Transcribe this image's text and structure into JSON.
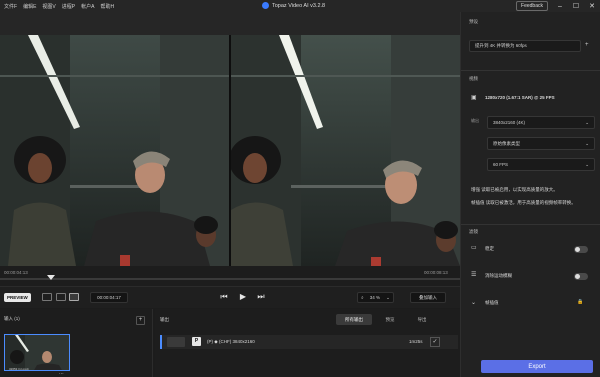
{
  "menus": [
    "文件F",
    "编辑E",
    "视图V",
    "进程P",
    "帐户A",
    "帮助H"
  ],
  "app": {
    "title": "Topaz Video AI  v3.2.8",
    "feedback": "Feedback"
  },
  "timeline": {
    "start": "00:00:04:13",
    "end": "00:00:08:13",
    "progress": 0.11
  },
  "controls": {
    "preview_label": "PREVIEW",
    "timecode": "00:00:04:17",
    "zoom": "34 %",
    "compare": "叠加输入"
  },
  "input": {
    "header": "输入 (1)",
    "add": "+",
    "file_caption": "32653 (1).mp4"
  },
  "output": {
    "header": "输出",
    "tabs": [
      "所有输出",
      "预览",
      "导出"
    ],
    "row_p": "P",
    "row_spec": "(P)  ◆ (CHF)  3840x2160",
    "duration": "1m25s"
  },
  "right": {
    "preset_title": "预设",
    "preset_value": "提升到 4K 并转换为 60fps",
    "video_title": "视频",
    "source_info": "1280x720 (1.67:1 SAR) @ 25 FPS",
    "output_label": "输出",
    "resolution": "3840x2160 (4K)",
    "pixel_type": "原始像素类型",
    "fps": "60 FPS",
    "enhance_note": "增强  读取已被启用，以实现高质量的放大。",
    "interp_note": "帧插值  读取已被激活，用于高质量的视频帧率转换。",
    "filters_title": "滤镜",
    "stabilize": "稳定",
    "motion_blur": "消除运动模糊",
    "frame_interp": "帧插值",
    "export": "Export"
  },
  "colors": {
    "accent": "#4b8cff",
    "export": "#5b6fe6",
    "panel": "#222222"
  }
}
